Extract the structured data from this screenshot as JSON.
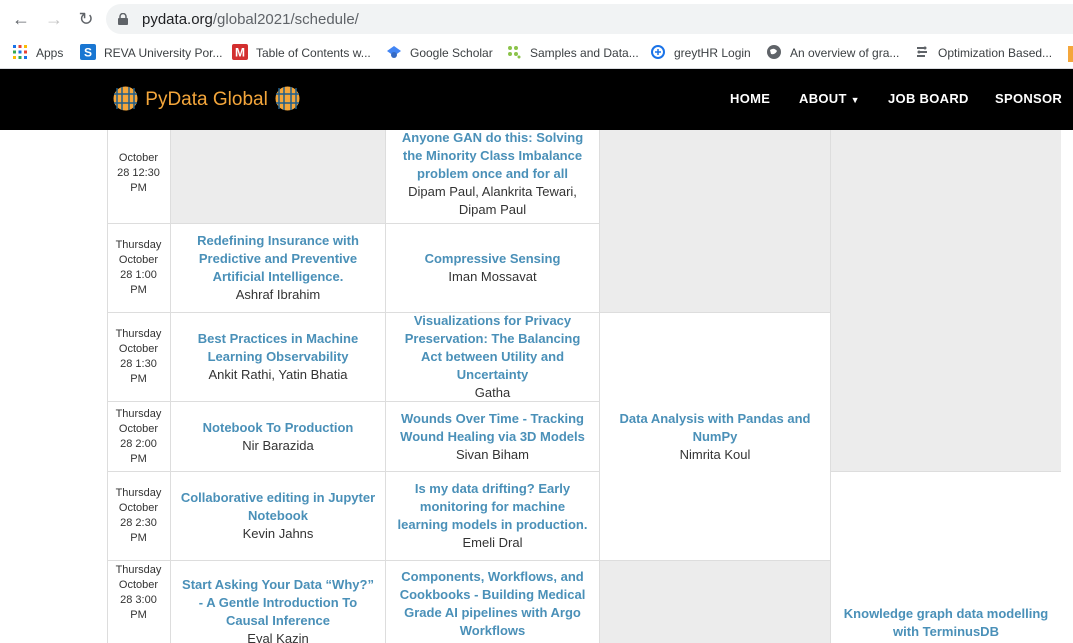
{
  "browser": {
    "url_host": "pydata.org",
    "url_path": "/global2021/schedule/",
    "bookmarks": [
      {
        "label": "Apps"
      },
      {
        "label": "REVA University Por..."
      },
      {
        "label": "Table of Contents w..."
      },
      {
        "label": "Google Scholar"
      },
      {
        "label": "Samples and Data..."
      },
      {
        "label": "greytHR Login"
      },
      {
        "label": "An overview of gra..."
      },
      {
        "label": "Optimization Based..."
      }
    ]
  },
  "site": {
    "logo_py": "PyData",
    "logo_global": "Global",
    "nav": [
      "HOME",
      "ABOUT",
      "JOB BOARD",
      "SPONSOR"
    ],
    "colors": {
      "header_bg": "#000000",
      "link": "#4a90b8",
      "logo": "#f4a63b"
    }
  },
  "schedule": {
    "rows": [
      {
        "time": [
          "October",
          "28 12:30",
          "PM"
        ],
        "talks": [
          null,
          {
            "title": "Anyone GAN do this: Solving the Minority Class Imbalance problem once and for all",
            "speaker": "Dipam Paul, Alankrita Tewari, Dipam Paul"
          }
        ]
      },
      {
        "time": [
          "Thursday",
          "October",
          "28 1:00",
          "PM"
        ],
        "talks": [
          {
            "title": "Redefining Insurance with Predictive and Preventive Artificial Intelligence.",
            "speaker": "Ashraf Ibrahim"
          },
          {
            "title": "Compressive Sensing",
            "speaker": "Iman Mossavat"
          }
        ]
      },
      {
        "time": [
          "Thursday",
          "October",
          "28 1:30",
          "PM"
        ],
        "talks": [
          {
            "title": "Best Practices in Machine Learning Observability",
            "speaker": "Ankit Rathi, Yatin Bhatia"
          },
          {
            "title": "Visualizations for Privacy Preservation: The Balancing Act between Utility and Uncertainty",
            "speaker": "Gatha"
          }
        ]
      },
      {
        "time": [
          "Thursday",
          "October",
          "28 2:00",
          "PM"
        ],
        "talks": [
          {
            "title": "Notebook To Production",
            "speaker": "Nir Barazida"
          },
          {
            "title": "Wounds Over Time - Tracking Wound Healing via 3D Models",
            "speaker": "Sivan Biham"
          }
        ]
      },
      {
        "time": [
          "Thursday",
          "October",
          "28 2:30",
          "PM"
        ],
        "talks": [
          {
            "title": "Collaborative editing in Jupyter Notebook",
            "speaker": "Kevin Jahns"
          },
          {
            "title": "Is my data drifting? Early monitoring for machine learning models in production.",
            "speaker": "Emeli Dral"
          }
        ]
      },
      {
        "time": [
          "Thursday",
          "October",
          "28 3:00",
          "PM"
        ],
        "talks": [
          {
            "title": "Start Asking Your Data “Why?” - A Gentle Introduction To Causal Inference",
            "speaker": "Eyal Kazin"
          },
          {
            "title": "Components, Workflows, and Cookbooks - Building Medical Grade AI pipelines with Argo Workflows",
            "speaker": ""
          }
        ]
      }
    ],
    "col3": {
      "title": "Data Analysis with Pandas and NumPy",
      "speaker": "Nimrita Koul"
    },
    "col4": {
      "title": "Knowledge graph data modelling with TerminusDB",
      "speaker": ""
    }
  }
}
